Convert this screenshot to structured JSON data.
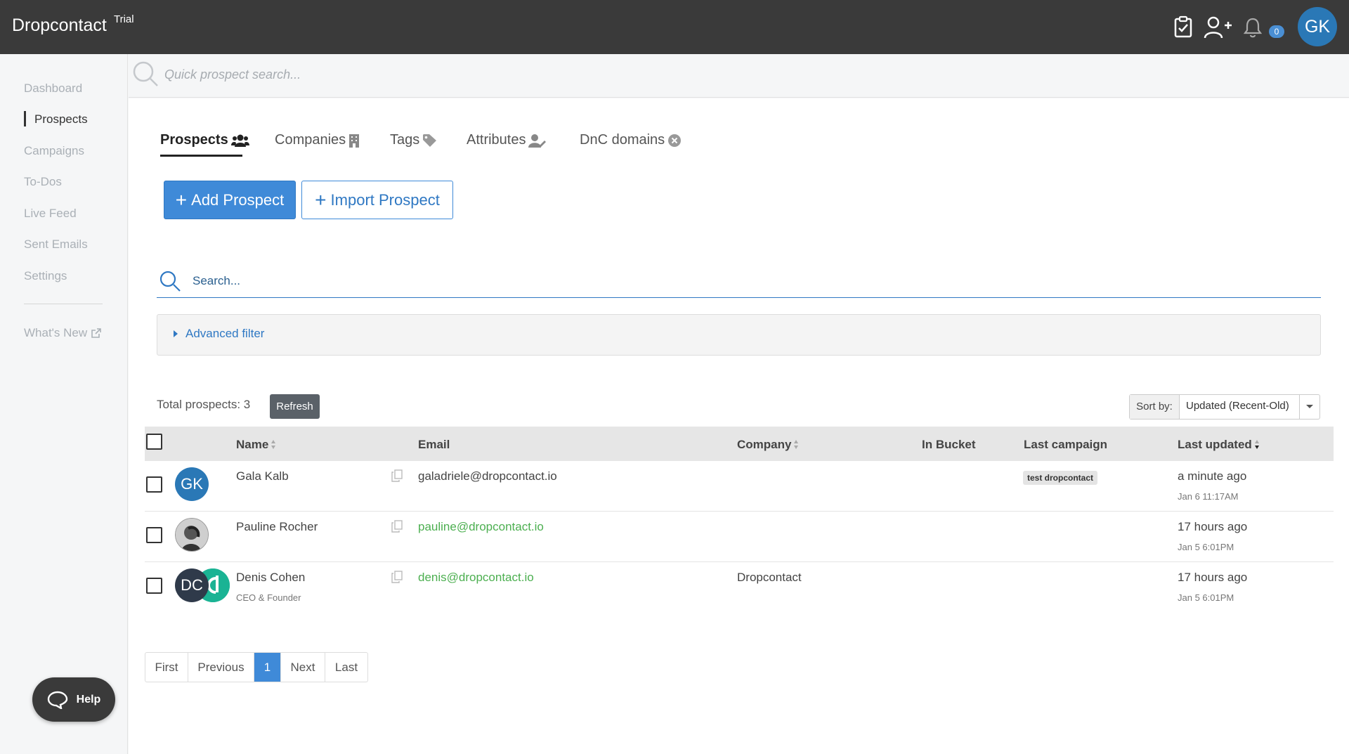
{
  "app": {
    "brand": "Dropcontact",
    "plan_badge": "Trial",
    "notifications_count": "0",
    "user_initials": "GK"
  },
  "sidebar": {
    "items": [
      {
        "label": "Dashboard"
      },
      {
        "label": "Prospects"
      },
      {
        "label": "Campaigns"
      },
      {
        "label": "To-Dos"
      },
      {
        "label": "Live Feed"
      },
      {
        "label": "Sent Emails"
      },
      {
        "label": "Settings"
      }
    ],
    "whats_new": "What's New"
  },
  "quick_search": {
    "placeholder": "Quick prospect search..."
  },
  "tabs": [
    {
      "label": "Prospects"
    },
    {
      "label": "Companies"
    },
    {
      "label": "Tags"
    },
    {
      "label": "Attributes"
    },
    {
      "label": "DnC domains"
    }
  ],
  "actions": {
    "add_prospect": "Add Prospect",
    "import_prospect": "Import Prospect"
  },
  "search": {
    "placeholder": "Search..."
  },
  "advanced_filter": "Advanced filter",
  "summary": {
    "total_label": "Total prospects: 3",
    "refresh": "Refresh"
  },
  "sort": {
    "label": "Sort by:",
    "value": "Updated (Recent-Old)"
  },
  "table": {
    "headers": {
      "name": "Name",
      "email": "Email",
      "company": "Company",
      "in_bucket": "In Bucket",
      "last_campaign": "Last campaign",
      "last_updated": "Last updated"
    },
    "rows": [
      {
        "initials": "GK",
        "name": "Gala Kalb",
        "title": "",
        "email": "galadriele@dropcontact.io",
        "company": "",
        "campaign": "test dropcontact",
        "updated": "a minute ago",
        "updated_date": "Jan 6 11:17AM"
      },
      {
        "initials": "",
        "name": "Pauline Rocher",
        "title": "",
        "email": "pauline@dropcontact.io",
        "company": "",
        "campaign": "",
        "updated": "17 hours ago",
        "updated_date": "Jan 5 6:01PM"
      },
      {
        "initials": "DC",
        "name": "Denis Cohen",
        "title": "CEO & Founder",
        "email": "denis@dropcontact.io",
        "company": "Dropcontact",
        "campaign": "",
        "updated": "17 hours ago",
        "updated_date": "Jan 5 6:01PM"
      }
    ]
  },
  "pagination": {
    "first": "First",
    "previous": "Previous",
    "current": "1",
    "next": "Next",
    "last": "Last"
  },
  "help": "Help",
  "colors": {
    "accent": "#3f8ad8",
    "topbar": "#3a3a3a",
    "verified_email": "#4caf50"
  }
}
